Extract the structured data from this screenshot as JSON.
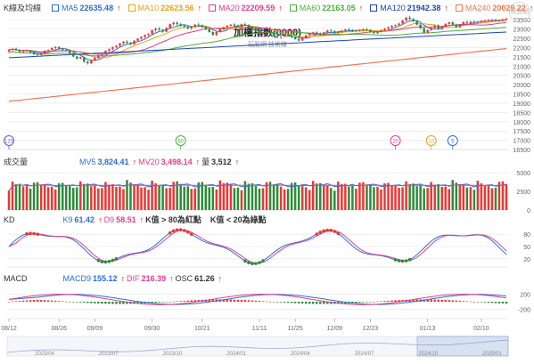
{
  "main_legend": {
    "title": "K線及均線",
    "items": [
      {
        "label": "MA5",
        "value": "22635.48",
        "color": "#2b6ed8"
      },
      {
        "label": "MA10",
        "value": "22623.56",
        "color": "#e8a317"
      },
      {
        "label": "MA20",
        "value": "22209.59",
        "color": "#e0408a"
      },
      {
        "label": "MA60",
        "value": "22163.05",
        "color": "#4caf3a"
      },
      {
        "label": "MA120",
        "value": "21942.38",
        "color": "#1c46b8"
      },
      {
        "label": "MA240",
        "value": "20029.22",
        "color": "#f07850"
      }
    ]
  },
  "watermark": "玩股網",
  "chart_title": "加權指數(0000)",
  "chart_subtitle": "玩股網 技術線",
  "volume_legend": {
    "title": "成交量",
    "items": [
      {
        "label": "MV5",
        "value": "3,824.41",
        "color": "#2b6ed8"
      },
      {
        "label": "MV20",
        "value": "3,498.14",
        "color": "#e0408a"
      },
      {
        "label": "量",
        "value": "3,512",
        "color": "#333333"
      }
    ]
  },
  "kd_legend": {
    "title": "KD",
    "items": [
      {
        "label": "K9",
        "value": "61.42",
        "color": "#2b6ed8"
      },
      {
        "label": "D9",
        "value": "58.51",
        "color": "#e0408a"
      },
      {
        "label": "K值 > 80為紅點",
        "value": "",
        "color": "#333333"
      },
      {
        "label": "K值 < 20為綠點",
        "value": "",
        "color": "#333333"
      }
    ]
  },
  "macd_legend": {
    "title": "MACD",
    "items": [
      {
        "label": "MACD9",
        "value": "155.12",
        "color": "#2b6ed8"
      },
      {
        "label": "DIF",
        "value": "216.39",
        "color": "#e0408a"
      },
      {
        "label": "OSC",
        "value": "61.26",
        "color": "#333333"
      }
    ]
  },
  "markers": [
    {
      "label": "120",
      "color": "#6a5acd",
      "bar": 0
    },
    {
      "label": "60",
      "color": "#4caf3a",
      "bar": 48
    },
    {
      "label": "20",
      "color": "#e0408a",
      "bar": 108
    },
    {
      "label": "10",
      "color": "#e8a317",
      "bar": 118
    },
    {
      "label": "5",
      "color": "#2b6ed8",
      "bar": 124
    }
  ],
  "x_dates": [
    "08/12",
    "08/26",
    "09/09",
    "09/30",
    "10/21",
    "11/11",
    "11/25",
    "12/09",
    "12/23",
    "01/13",
    "02/10"
  ],
  "x_dates_bar": [
    0,
    14,
    24,
    40,
    54,
    70,
    80,
    91,
    101,
    117,
    132
  ],
  "nav_dates": [
    "2023/04",
    "2023/07",
    "2023/10",
    "2024/01",
    "2024/04",
    "2024/07",
    "2024/10",
    "2025/01"
  ],
  "colors": {
    "up": "#e53935",
    "down": "#2e8b3a",
    "grid": "#e6e6e6",
    "axis": "#666666"
  },
  "chart_data": {
    "type": "candlestick",
    "title": "加權指數(0000)",
    "y_ticks": [
      16500,
      17000,
      17500,
      18000,
      18500,
      19000,
      19500,
      20000,
      20500,
      21000,
      21500,
      22000,
      22500,
      23000,
      23500
    ],
    "ylim": [
      16500,
      23800
    ],
    "candles": [
      [
        21800,
        21920,
        21700,
        21880
      ],
      [
        21880,
        21960,
        21790,
        21940
      ],
      [
        21940,
        22000,
        21820,
        21860
      ],
      [
        21860,
        21900,
        21720,
        21760
      ],
      [
        21760,
        21850,
        21700,
        21820
      ],
      [
        21820,
        21900,
        21760,
        21850
      ],
      [
        21850,
        21880,
        21700,
        21740
      ],
      [
        21740,
        21780,
        21600,
        21640
      ],
      [
        21640,
        21700,
        21520,
        21600
      ],
      [
        21600,
        21720,
        21550,
        21690
      ],
      [
        21690,
        21860,
        21650,
        21830
      ],
      [
        21830,
        21900,
        21760,
        21880
      ],
      [
        21880,
        22010,
        21820,
        21980
      ],
      [
        21980,
        22080,
        21900,
        22040
      ],
      [
        22040,
        22060,
        21900,
        21940
      ],
      [
        21940,
        22000,
        21820,
        21880
      ],
      [
        21880,
        21920,
        21780,
        21820
      ],
      [
        21820,
        21860,
        21650,
        21700
      ],
      [
        21700,
        21750,
        21480,
        21520
      ],
      [
        21520,
        21560,
        21350,
        21400
      ],
      [
        21400,
        21520,
        21380,
        21480
      ],
      [
        21480,
        21520,
        21180,
        21240
      ],
      [
        21240,
        21300,
        21080,
        21150
      ],
      [
        21150,
        21350,
        21120,
        21320
      ],
      [
        21320,
        21480,
        21250,
        21450
      ],
      [
        21450,
        21620,
        21400,
        21580
      ],
      [
        21580,
        21700,
        21500,
        21660
      ],
      [
        21660,
        21860,
        21620,
        21830
      ],
      [
        21830,
        21960,
        21780,
        21920
      ],
      [
        21920,
        22060,
        21860,
        22020
      ],
      [
        22020,
        22140,
        21960,
        22100
      ],
      [
        22100,
        22260,
        22050,
        22230
      ],
      [
        22230,
        22360,
        22180,
        22320
      ],
      [
        22320,
        22400,
        22200,
        22260
      ],
      [
        22260,
        22320,
        22120,
        22180
      ],
      [
        22180,
        22400,
        22150,
        22370
      ],
      [
        22370,
        22520,
        22320,
        22480
      ],
      [
        22480,
        22620,
        22420,
        22580
      ],
      [
        22580,
        22720,
        22500,
        22680
      ],
      [
        22680,
        22800,
        22600,
        22740
      ],
      [
        22740,
        22980,
        22700,
        22940
      ],
      [
        22940,
        23080,
        22860,
        23020
      ],
      [
        23020,
        23120,
        22900,
        22960
      ],
      [
        22960,
        23020,
        22800,
        22860
      ],
      [
        22860,
        23100,
        22840,
        23060
      ],
      [
        23060,
        23300,
        23020,
        23260
      ],
      [
        23260,
        23400,
        23180,
        23340
      ],
      [
        23340,
        23420,
        23200,
        23260
      ],
      [
        23260,
        23340,
        23120,
        23180
      ],
      [
        23180,
        23260,
        23060,
        23120
      ],
      [
        23120,
        23200,
        22980,
        23040
      ],
      [
        23040,
        23160,
        22960,
        23120
      ],
      [
        23120,
        23280,
        23060,
        23240
      ],
      [
        23240,
        23340,
        23160,
        23200
      ],
      [
        23200,
        23260,
        23060,
        23100
      ],
      [
        23100,
        23160,
        22940,
        22980
      ],
      [
        22980,
        23020,
        22800,
        22840
      ],
      [
        22840,
        22880,
        22640,
        22680
      ],
      [
        22680,
        22880,
        22620,
        22840
      ],
      [
        22840,
        23040,
        22800,
        22980
      ],
      [
        22980,
        23140,
        22940,
        23100
      ],
      [
        23100,
        23220,
        23040,
        23180
      ],
      [
        23180,
        23280,
        23100,
        23240
      ],
      [
        23240,
        23320,
        23140,
        23180
      ],
      [
        23180,
        23260,
        23080,
        23120
      ],
      [
        23120,
        23300,
        23080,
        23260
      ],
      [
        23260,
        23360,
        23180,
        23220
      ],
      [
        23220,
        23280,
        23080,
        23120
      ],
      [
        23120,
        23180,
        22960,
        23000
      ],
      [
        23000,
        23060,
        22860,
        22900
      ],
      [
        22900,
        22960,
        22740,
        22780
      ],
      [
        22780,
        22860,
        22700,
        22820
      ],
      [
        22820,
        22900,
        22740,
        22860
      ],
      [
        22860,
        22900,
        22720,
        22760
      ],
      [
        22760,
        22800,
        22600,
        22640
      ],
      [
        22640,
        22700,
        22500,
        22560
      ],
      [
        22560,
        22640,
        22460,
        22600
      ],
      [
        22600,
        22720,
        22560,
        22680
      ],
      [
        22680,
        22760,
        22600,
        22640
      ],
      [
        22640,
        22700,
        22520,
        22560
      ],
      [
        22560,
        22600,
        22420,
        22460
      ],
      [
        22460,
        22520,
        22320,
        22380
      ],
      [
        22380,
        22560,
        22360,
        22520
      ],
      [
        22520,
        22700,
        22480,
        22660
      ],
      [
        22660,
        22780,
        22600,
        22740
      ],
      [
        22740,
        22860,
        22680,
        22820
      ],
      [
        22820,
        22880,
        22700,
        22760
      ],
      [
        22760,
        22820,
        22640,
        22700
      ],
      [
        22700,
        22860,
        22660,
        22820
      ],
      [
        22820,
        22960,
        22780,
        22920
      ],
      [
        22920,
        23000,
        22820,
        22880
      ],
      [
        22880,
        22940,
        22760,
        22800
      ],
      [
        22800,
        22900,
        22740,
        22860
      ],
      [
        22860,
        22960,
        22800,
        22920
      ],
      [
        22920,
        23020,
        22860,
        22980
      ],
      [
        22980,
        23060,
        22900,
        22940
      ],
      [
        22940,
        23000,
        22840,
        22880
      ],
      [
        22880,
        22960,
        22820,
        22920
      ],
      [
        22920,
        23000,
        22860,
        22960
      ],
      [
        22960,
        23040,
        22900,
        22980
      ],
      [
        22980,
        23060,
        22900,
        22940
      ],
      [
        22940,
        23000,
        22800,
        22840
      ],
      [
        22840,
        22900,
        22740,
        22780
      ],
      [
        22780,
        22900,
        22740,
        22860
      ],
      [
        22860,
        22980,
        22820,
        22940
      ],
      [
        22940,
        23060,
        22880,
        23020
      ],
      [
        23020,
        23140,
        22960,
        23100
      ],
      [
        23100,
        23220,
        23040,
        23180
      ],
      [
        23180,
        23260,
        23100,
        23220
      ],
      [
        23220,
        23340,
        23160,
        23300
      ],
      [
        23300,
        23500,
        23260,
        23460
      ],
      [
        23460,
        23660,
        23420,
        23620
      ],
      [
        23620,
        23720,
        23480,
        23540
      ],
      [
        23540,
        23600,
        23380,
        23420
      ],
      [
        23420,
        23480,
        23200,
        23240
      ],
      [
        23240,
        23300,
        23000,
        23040
      ],
      [
        23040,
        23080,
        22760,
        22800
      ],
      [
        22800,
        22980,
        22760,
        22940
      ],
      [
        22940,
        23100,
        22900,
        23060
      ],
      [
        23060,
        23220,
        23020,
        23180
      ],
      [
        23180,
        23260,
        22960,
        23000
      ],
      [
        23000,
        23180,
        22960,
        23140
      ],
      [
        23140,
        23320,
        23100,
        23280
      ],
      [
        23280,
        23400,
        23220,
        23360
      ],
      [
        23360,
        23420,
        23200,
        23240
      ],
      [
        23240,
        23300,
        23060,
        23100
      ],
      [
        23100,
        23280,
        23060,
        23240
      ],
      [
        23240,
        23420,
        23200,
        23380
      ],
      [
        23380,
        23460,
        23280,
        23320
      ],
      [
        23320,
        23440,
        23260,
        23400
      ],
      [
        23400,
        23480,
        23300,
        23360
      ],
      [
        23360,
        23440,
        23280,
        23400
      ],
      [
        23400,
        23500,
        23340,
        23440
      ],
      [
        23440,
        23520,
        23380,
        23460
      ],
      [
        23460,
        23560,
        23400,
        23480
      ],
      [
        23480,
        23580,
        23420,
        23500
      ],
      [
        23500,
        23560,
        23400,
        23440
      ],
      [
        23440,
        23520,
        23380,
        23480
      ],
      [
        23480,
        23580,
        23420,
        23520
      ],
      [
        23520,
        23620,
        23460,
        23560
      ]
    ],
    "volume_y_ticks": [
      0,
      2500,
      5000
    ],
    "volume_ylim": [
      0,
      5500
    ],
    "kd_y_ticks": [
      20,
      50,
      80
    ],
    "kd_ylim": [
      0,
      100
    ],
    "macd_y_ticks": [
      -200,
      200
    ],
    "macd_ylim": [
      -450,
      450
    ]
  }
}
